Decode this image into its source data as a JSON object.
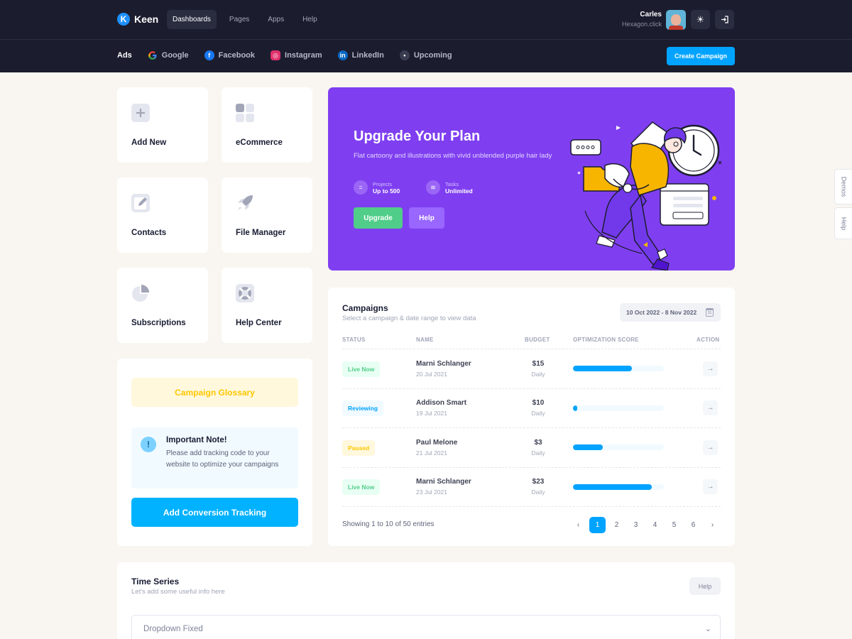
{
  "brand": {
    "name": "Keen"
  },
  "topnav": [
    "Dashboards",
    "Pages",
    "Apps",
    "Help"
  ],
  "user": {
    "name": "Carles",
    "company": "Hexagon.click"
  },
  "subnav": {
    "title": "Ads",
    "items": [
      "Google",
      "Facebook",
      "Instagram",
      "LinkedIn",
      "Upcoming"
    ],
    "create_label": "Create Campaign"
  },
  "side_tabs": [
    "Demos",
    "Help"
  ],
  "tiles": [
    "Add New",
    "eCommerce",
    "Contacts",
    "File Manager",
    "Subscriptions",
    "Help Center"
  ],
  "glossary": {
    "button": "Campaign Glossary",
    "note_title": "Important Note!",
    "note_body": "Please add tracking code to your website to optimize your campaigns",
    "conversion_button": "Add Conversion Tracking"
  },
  "promo": {
    "title": "Upgrade Your Plan",
    "description": "Flat cartoony and illustrations with vivid unblended purple hair lady",
    "stats": [
      {
        "label": "Projects",
        "value": "Up to 500"
      },
      {
        "label": "Tasks",
        "value": "Unlimited"
      }
    ],
    "upgrade_label": "Upgrade",
    "help_label": "Help"
  },
  "campaigns": {
    "title": "Campaigns",
    "subtitle": "Select a campaign & date range to view data",
    "date_range": "10 Oct 2022 - 8 Nov 2022",
    "calendar_day": "31",
    "columns": [
      "STATUS",
      "NAME",
      "BUDGET",
      "OPTIMIZATION SCORE",
      "ACTION"
    ],
    "rows": [
      {
        "status": "Live Now",
        "name": "Marni Schlanger",
        "date": "20 Jul 2021",
        "budget": "$15",
        "period": "Daily",
        "score": 65
      },
      {
        "status": "Reviewing",
        "name": "Addison Smart",
        "date": "19 Jul 2021",
        "budget": "$10",
        "period": "Daily",
        "score": 5
      },
      {
        "status": "Paused",
        "name": "Paul Melone",
        "date": "21 Jul 2021",
        "budget": "$3",
        "period": "Daily",
        "score": 33
      },
      {
        "status": "Live Now",
        "name": "Marni Schlanger",
        "date": "23 Jul 2021",
        "budget": "$23",
        "period": "Daily",
        "score": 87
      }
    ],
    "showing": "Showing 1 to 10 of 50 entries",
    "pages": [
      "1",
      "2",
      "3",
      "4",
      "5",
      "6"
    ],
    "active_page": "1"
  },
  "time_series": {
    "title": "Time Series",
    "subtitle": "Let's add some useful info here",
    "help_label": "Help",
    "dropdown_label": "Dropdown Fixed"
  },
  "colors": {
    "accent": "#00a3ff",
    "promo": "#7f3ff0",
    "success": "#50cd89",
    "warning": "#ffc700"
  }
}
